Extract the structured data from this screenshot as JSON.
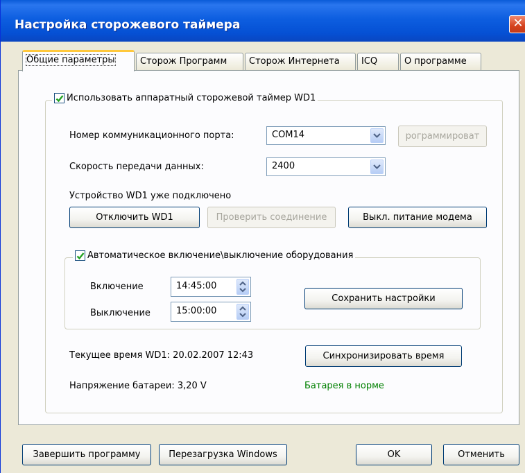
{
  "window": {
    "title": "Настройка сторожевого таймера"
  },
  "tabs": [
    {
      "label": "Общие параметры",
      "active": true
    },
    {
      "label": "Сторож Программ"
    },
    {
      "label": "Сторож Интернета"
    },
    {
      "label": "ICQ"
    },
    {
      "label": "О программе"
    }
  ],
  "hw_group": {
    "checkbox_label": "Использовать аппаратный сторожевой таймер WD1",
    "checked": true,
    "port_label": "Номер коммуникационного порта:",
    "port_value": "COM14",
    "program_button": "рограммироват",
    "speed_label": "Скорость передачи данных:",
    "speed_value": "2400",
    "status_text": "Устройство WD1 уже подключено",
    "disconnect_button": "Отключить WD1",
    "check_button": "Проверить соединение",
    "modem_button": "Выкл. питание модема"
  },
  "auto_group": {
    "checkbox_label": "Автоматическое включение\\выключение оборудования",
    "checked": true,
    "on_label": "Включение",
    "on_time": "14:45:00",
    "off_label": "Выключение",
    "off_time": "15:00:00",
    "save_button": "Сохранить настройки"
  },
  "status": {
    "current_time_text": "Текущее время WD1: 20.02.2007 12:43",
    "sync_button": "Синхронизировать время",
    "battery_text": "Напряжение батареи: 3,20 V",
    "battery_status": "Батарея в норме",
    "battery_status_color": "#008000"
  },
  "footer": {
    "exit_button": "Завершить программу",
    "reboot_button": "Перезагрузка Windows",
    "ok_button": "OK",
    "cancel_button": "Отменить"
  },
  "icons": {
    "checkbox": "checkmark-icon",
    "dropdown": "chevron-down-icon",
    "spinner": "up-down-arrows-icon",
    "close": "close-icon"
  }
}
